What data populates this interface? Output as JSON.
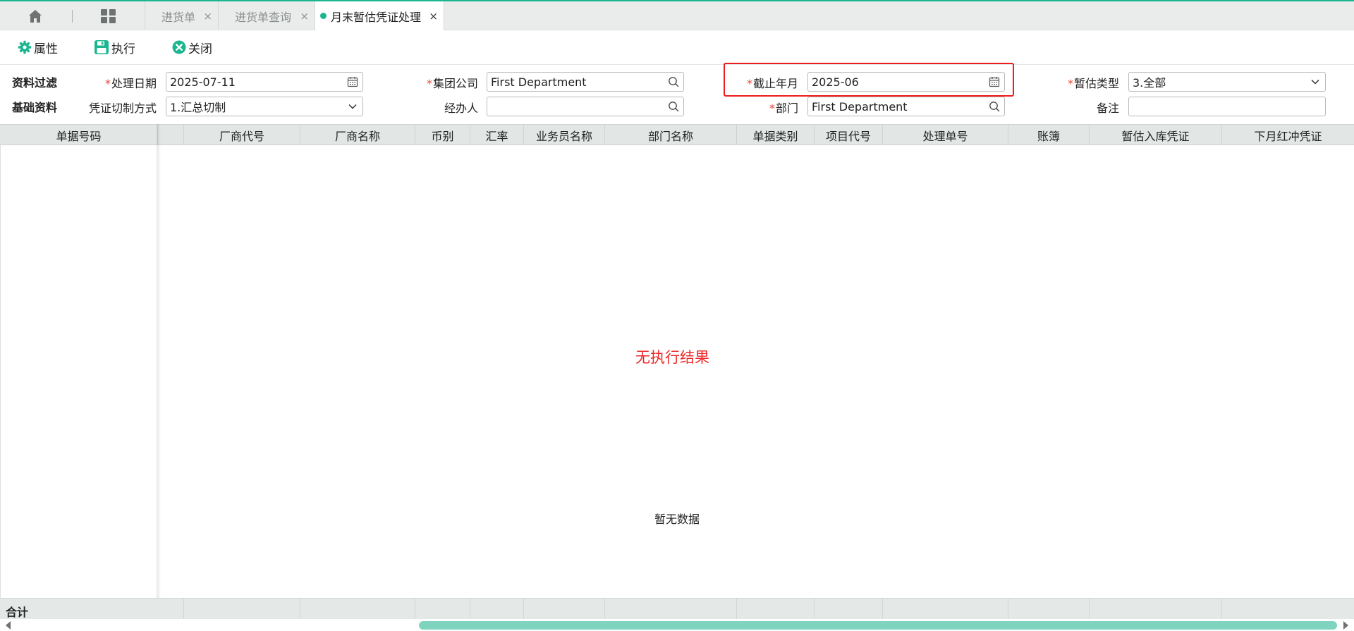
{
  "colors": {
    "accent": "#1bb58f",
    "required": "#e9473a",
    "no_result": "#ee2a2a",
    "highlight_box": "#ee1c1c",
    "scroll_thumb": "#7fd4bf"
  },
  "tabbar": {
    "tabs": [
      {
        "label": "进货单",
        "active": false
      },
      {
        "label": "进货单查询",
        "active": false
      },
      {
        "label": "月末暂估凭证处理",
        "active": true
      }
    ],
    "close_glyph": "×"
  },
  "toolbar": {
    "properties_label": "属性",
    "execute_label": "执行",
    "close_label": "关闭"
  },
  "filter": {
    "section_filter": "资料过滤",
    "section_basic": "基础资料",
    "fields": {
      "process_date": {
        "label": "处理日期",
        "value": "2025-07-11",
        "required": true
      },
      "group_company": {
        "label": "集团公司",
        "value": "First Department",
        "required": true
      },
      "cutoff_month": {
        "label": "截止年月",
        "value": "2025-06",
        "required": true
      },
      "estimate_type": {
        "label": "暂估类型",
        "value": "3.全部",
        "required": true
      },
      "voucher_mode": {
        "label": "凭证切制方式",
        "value": "1.汇总切制",
        "required": false
      },
      "handler": {
        "label": "经办人",
        "value": "",
        "required": false
      },
      "department": {
        "label": "部门",
        "value": "First Department",
        "required": true
      },
      "remark": {
        "label": "备注",
        "value": "",
        "required": false
      }
    },
    "required_mark": "*"
  },
  "grid": {
    "columns": [
      "单据号码",
      "厂商代号",
      "厂商名称",
      "币别",
      "汇率",
      "业务员名称",
      "部门名称",
      "单据类别",
      "项目代号",
      "处理单号",
      "账簿",
      "暂估入库凭证",
      "下月红冲凭证"
    ],
    "no_result_text": "无执行结果",
    "empty_text": "暂无数据",
    "total_label": "合计"
  }
}
